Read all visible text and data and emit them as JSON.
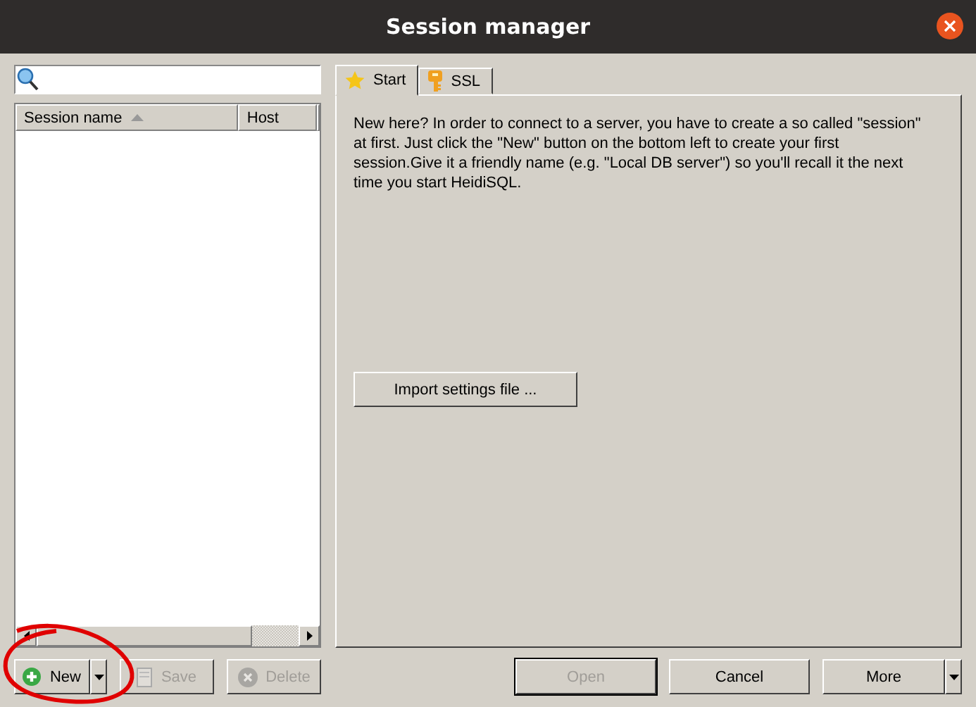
{
  "window": {
    "title": "Session manager"
  },
  "session_list": {
    "columns": [
      {
        "label": "Session name",
        "sorted": true
      },
      {
        "label": "Host",
        "sorted": false
      }
    ]
  },
  "left_buttons": [
    {
      "kind": "split",
      "label": "New",
      "disabled": false
    },
    {
      "kind": "plain",
      "label": "Save",
      "disabled": true
    },
    {
      "kind": "plain",
      "label": "Delete",
      "disabled": true
    }
  ],
  "tabs": [
    {
      "label": "Start",
      "selected": true
    },
    {
      "label": "SSL",
      "selected": false
    }
  ],
  "start_text": "New here? In order to connect to a server, you have to create a so called \"session\" at first. Just click the \"New\" button on the bottom left to create your first session.Give it a friendly name (e.g. \"Local DB server\") so you'll recall it the next time you start HeidiSQL.",
  "import_button": "Import settings file ...",
  "bottom_buttons": [
    {
      "kind": "plain",
      "label": "Open",
      "disabled": true,
      "focused": true
    },
    {
      "kind": "plain",
      "label": "Cancel",
      "disabled": false,
      "focused": false
    },
    {
      "kind": "split",
      "label": "More",
      "disabled": false,
      "focused": false
    }
  ],
  "annotation": {
    "kind": "circle"
  }
}
